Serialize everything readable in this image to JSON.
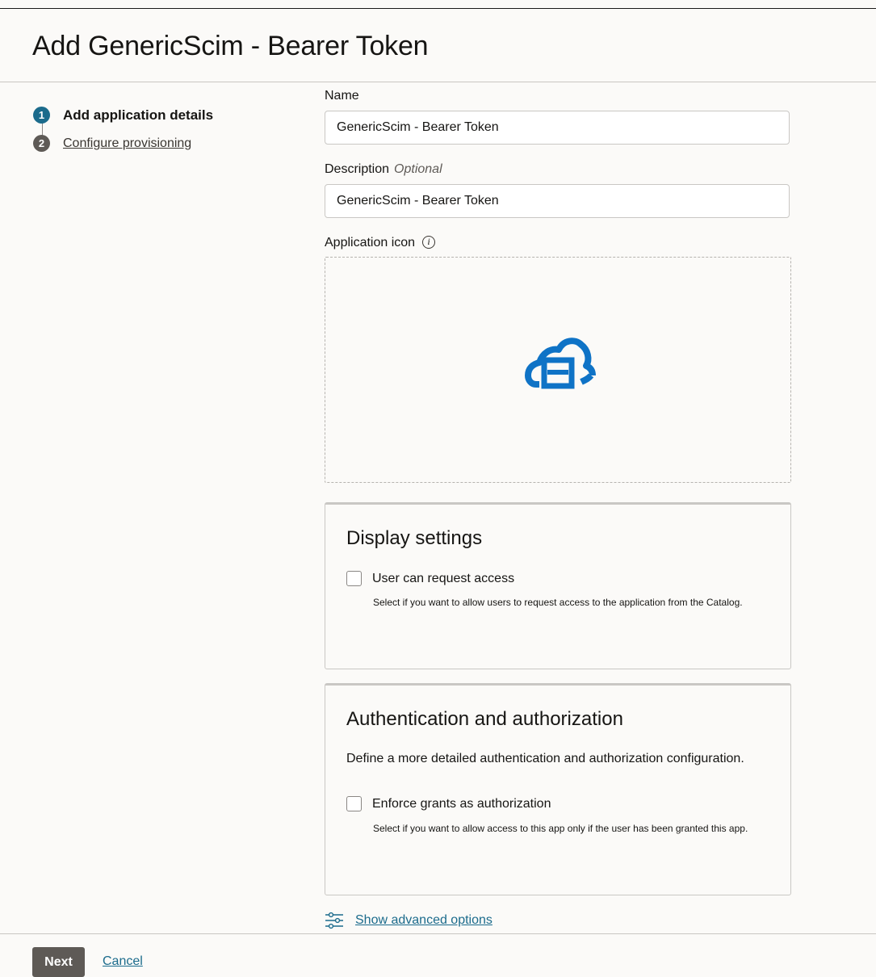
{
  "page": {
    "title": "Add GenericScim - Bearer Token"
  },
  "steps": [
    {
      "number": "1",
      "label": "Add application details",
      "state": "current"
    },
    {
      "number": "2",
      "label": "Configure provisioning",
      "state": "upcoming"
    }
  ],
  "form": {
    "name": {
      "label": "Name",
      "value": "GenericScim - Bearer Token"
    },
    "description": {
      "label": "Description",
      "optional_tag": "Optional",
      "value": "GenericScim - Bearer Token"
    },
    "application_icon": {
      "label": "Application icon",
      "info_icon": "info-icon",
      "icon": "cloud-app-icon"
    }
  },
  "display_settings": {
    "title": "Display settings",
    "checkbox_label": "User can request access",
    "checkbox_checked": false,
    "help": "Select if you want to allow users to request access to the application from the Catalog."
  },
  "auth": {
    "title": "Authentication and authorization",
    "description": "Define a more detailed authentication and authorization configuration.",
    "checkbox_label": "Enforce grants as authorization",
    "checkbox_checked": false,
    "help": "Select if you want to allow access to this app only if the user has been granted this app."
  },
  "advanced": {
    "label": "Show advanced options",
    "icon": "sliders-icon"
  },
  "footer": {
    "next_label": "Next",
    "cancel_label": "Cancel"
  },
  "colors": {
    "accent": "#1b6b8c",
    "icon_blue": "#0f73c6",
    "button_gray": "#5e5a56"
  }
}
